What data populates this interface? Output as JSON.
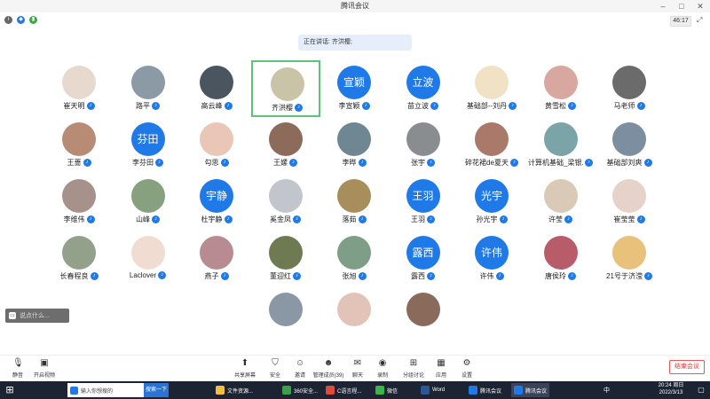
{
  "window": {
    "title": "腾讯会议",
    "minimize": "–",
    "maximize": "□",
    "close": "✕"
  },
  "status": {
    "info": "i",
    "shield": "◆",
    "signal": "▮",
    "timer": "46:17",
    "fullscreen": "⤢"
  },
  "speaking": {
    "text": "正在讲话: 齐洪樱;"
  },
  "participants": [
    {
      "name": "崔天明",
      "avatar": "photo",
      "color": "#e8d9cf"
    },
    {
      "name": "路平",
      "avatar": "photo",
      "color": "#8c9aa6"
    },
    {
      "name": "高云峰",
      "avatar": "photo",
      "color": "#4a5560"
    },
    {
      "name": "齐洪樱",
      "avatar": "photo",
      "color": "#c9c3a8",
      "selected": true
    },
    {
      "name": "李宣颖",
      "avatar": "text",
      "label": "宣颖"
    },
    {
      "name": "苗立波",
      "avatar": "text",
      "label": "立波"
    },
    {
      "name": "基础部--刘丹",
      "avatar": "photo",
      "color": "#f1e2c6"
    },
    {
      "name": "黄雪松",
      "avatar": "photo",
      "color": "#d7a7a0"
    },
    {
      "name": "马老师",
      "avatar": "photo",
      "color": "#6b6b6b"
    },
    {
      "name": "王蔷",
      "avatar": "photo",
      "color": "#b78b74"
    },
    {
      "name": "李芬田",
      "avatar": "text",
      "label": "芬田"
    },
    {
      "name": "勾思",
      "avatar": "photo",
      "color": "#e9c6b5"
    },
    {
      "name": "王嫘",
      "avatar": "photo",
      "color": "#8d6b5a"
    },
    {
      "name": "李晔",
      "avatar": "photo",
      "color": "#6f8792"
    },
    {
      "name": "张宇",
      "avatar": "photo",
      "color": "#8a8d8f"
    },
    {
      "name": "碎花裙de夏天",
      "avatar": "photo",
      "color": "#a97a6a"
    },
    {
      "name": "计算机基础_梁银...",
      "avatar": "photo",
      "color": "#7aa4a7"
    },
    {
      "name": "基础部刘爽",
      "avatar": "photo",
      "color": "#7c8fa1"
    },
    {
      "name": "李维伟",
      "avatar": "photo",
      "color": "#a6928a"
    },
    {
      "name": "山峰",
      "avatar": "photo",
      "color": "#87a07e"
    },
    {
      "name": "杜宇静",
      "avatar": "text",
      "label": "宇静"
    },
    {
      "name": "奚金凤",
      "avatar": "photo",
      "color": "#c1c6cc"
    },
    {
      "name": "落茹",
      "avatar": "photo",
      "color": "#a88e5a"
    },
    {
      "name": "王羽",
      "avatar": "text",
      "label": "王羽"
    },
    {
      "name": "孙光宇",
      "avatar": "text",
      "label": "光宇"
    },
    {
      "name": "许莹",
      "avatar": "photo",
      "color": "#d9c9b6"
    },
    {
      "name": "崔莹莹",
      "avatar": "photo",
      "color": "#e6d2c8"
    },
    {
      "name": "长春程良",
      "avatar": "photo",
      "color": "#93a08a"
    },
    {
      "name": "Laclover",
      "avatar": "photo",
      "color": "#f0dcd0"
    },
    {
      "name": "燕子",
      "avatar": "photo",
      "color": "#b88a92"
    },
    {
      "name": "董迎红",
      "avatar": "photo",
      "color": "#6e7a52"
    },
    {
      "name": "张旭",
      "avatar": "photo",
      "color": "#7f9e88"
    },
    {
      "name": "露西",
      "avatar": "text",
      "label": "露西"
    },
    {
      "name": "许伟",
      "avatar": "text",
      "label": "许伟"
    },
    {
      "name": "唐侯玲",
      "avatar": "photo",
      "color": "#b85c6a"
    },
    {
      "name": "21号于济滢",
      "avatar": "photo",
      "color": "#e8c17a"
    },
    {
      "name": "",
      "avatar": "photo",
      "color": "#8a98a6"
    },
    {
      "name": "",
      "avatar": "photo",
      "color": "#e2c3b8"
    },
    {
      "name": "",
      "avatar": "photo",
      "color": "#8a6a5a"
    }
  ],
  "chat": {
    "placeholder": "说点什么..."
  },
  "toolbar": {
    "mute": "静音",
    "video": "开启视频",
    "share": "共享屏幕",
    "security": "安全",
    "invite": "邀请",
    "members": "管理成员(39)",
    "chat": "聊天",
    "record": "录制",
    "breakout": "分组讨论",
    "apps": "应用",
    "settings": "设置",
    "end": "结束会议"
  },
  "taskbar": {
    "start": "⊞",
    "search_text": "输入你想搜的",
    "search_button": "搜索一下",
    "apps": [
      {
        "label": "文件资源...",
        "color": "#f0c040"
      },
      {
        "label": "360安全...",
        "color": "#3aa14a"
      },
      {
        "label": "C语言程...",
        "color": "#e04a3a"
      },
      {
        "label": "微信",
        "color": "#3bb54a"
      },
      {
        "label": "Word",
        "color": "#2b5797"
      },
      {
        "label": "腾讯会议",
        "color": "#1f7ae8"
      },
      {
        "label": "腾讯会议",
        "color": "#1f7ae8"
      }
    ],
    "ime": "中",
    "time": "20:24 周日",
    "date": "2022/3/13",
    "notif": "▢"
  },
  "colors": {
    "accent": "#1f7ae8",
    "selected_border": "#5ac47a",
    "end": "#e33333"
  }
}
